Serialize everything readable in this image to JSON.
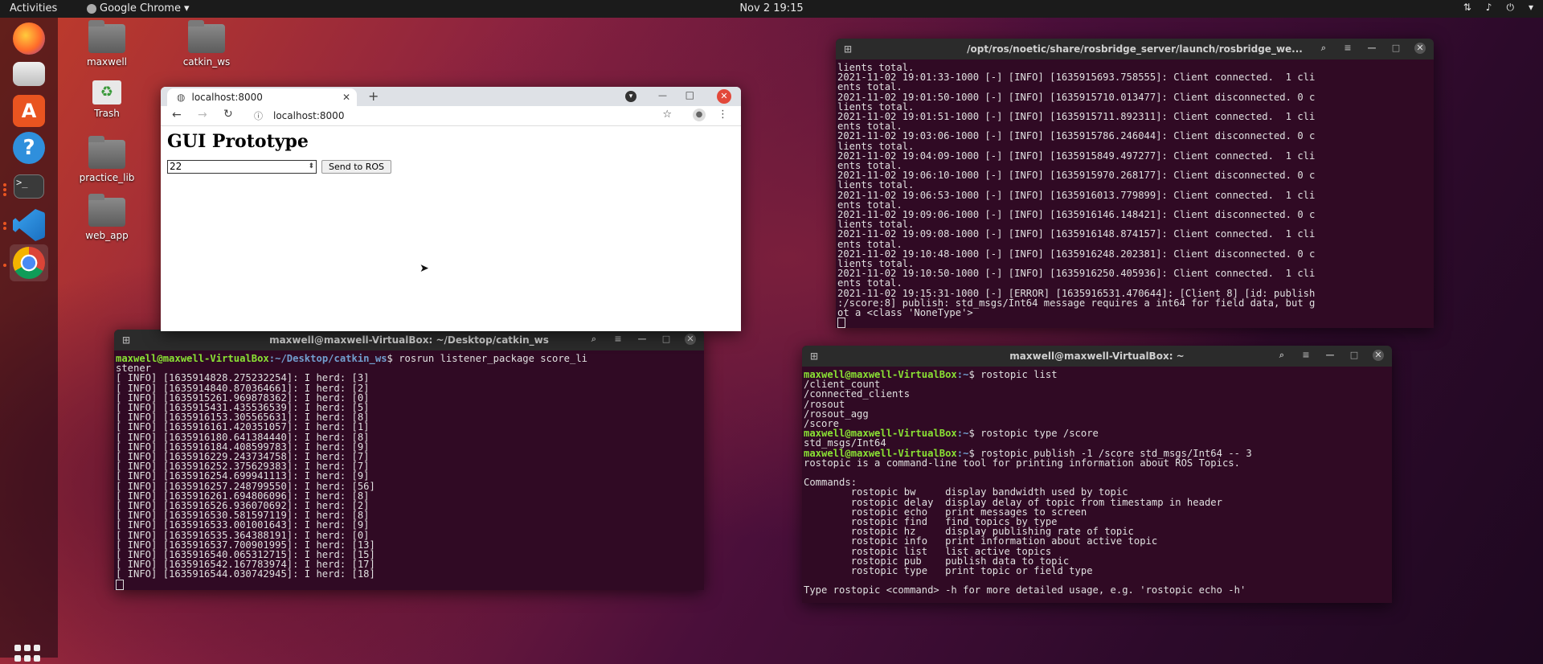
{
  "topbar": {
    "activities": "Activities",
    "app_name": "Google Chrome",
    "clock": "Nov 2  19:15"
  },
  "desktop_icons": [
    {
      "label": "maxwell"
    },
    {
      "label": "catkin_ws"
    },
    {
      "label": "Trash"
    },
    {
      "label": "practice_lib"
    },
    {
      "label": "web_app"
    }
  ],
  "browser": {
    "tab_title": "localhost:8000",
    "url": "localhost:8000",
    "heading": "GUI Prototype",
    "input_value": "22",
    "send_button": "Send to ROS"
  },
  "rosbridge_terminal": {
    "title": "/opt/ros/noetic/share/rosbridge_server/launch/rosbridge_we...",
    "lines": [
      "lients total.",
      "2021-11-02 19:01:33-1000 [-] [INFO] [1635915693.758555]: Client connected.  1 cli",
      "ents total.",
      "2021-11-02 19:01:50-1000 [-] [INFO] [1635915710.013477]: Client disconnected. 0 c",
      "lients total.",
      "2021-11-02 19:01:51-1000 [-] [INFO] [1635915711.892311]: Client connected.  1 cli",
      "ents total.",
      "2021-11-02 19:03:06-1000 [-] [INFO] [1635915786.246044]: Client disconnected. 0 c",
      "lients total.",
      "2021-11-02 19:04:09-1000 [-] [INFO] [1635915849.497277]: Client connected.  1 cli",
      "ents total.",
      "2021-11-02 19:06:10-1000 [-] [INFO] [1635915970.268177]: Client disconnected. 0 c",
      "lients total.",
      "2021-11-02 19:06:53-1000 [-] [INFO] [1635916013.779899]: Client connected.  1 cli",
      "ents total.",
      "2021-11-02 19:09:06-1000 [-] [INFO] [1635916146.148421]: Client disconnected. 0 c",
      "lients total.",
      "2021-11-02 19:09:08-1000 [-] [INFO] [1635916148.874157]: Client connected.  1 cli",
      "ents total.",
      "2021-11-02 19:10:48-1000 [-] [INFO] [1635916248.202381]: Client disconnected. 0 c",
      "lients total.",
      "2021-11-02 19:10:50-1000 [-] [INFO] [1635916250.405936]: Client connected.  1 cli",
      "ents total.",
      "2021-11-02 19:15:31-1000 [-] [ERROR] [1635916531.470644]: [Client 8] [id: publish",
      ":/score:8] publish: std_msgs/Int64 message requires a int64 for field data, but g",
      "ot a <class 'NoneType'>"
    ]
  },
  "listener_terminal": {
    "title": "maxwell@maxwell-VirtualBox: ~/Desktop/catkin_ws",
    "prompt_user": "maxwell@maxwell-VirtualBox",
    "prompt_path": ":~/Desktop/catkin_ws",
    "command": "$ rosrun listener_package score_li",
    "command_wrap": "stener",
    "lines": [
      "[ INFO] [1635914828.275232254]: I herd: [3]",
      "[ INFO] [1635914840.870364661]: I herd: [2]",
      "[ INFO] [1635915261.969878362]: I herd: [0]",
      "[ INFO] [1635915431.435536539]: I herd: [5]",
      "[ INFO] [1635916153.305565631]: I herd: [8]",
      "[ INFO] [1635916161.420351057]: I herd: [1]",
      "[ INFO] [1635916180.641384440]: I herd: [8]",
      "[ INFO] [1635916184.408599783]: I herd: [9]",
      "[ INFO] [1635916229.243734758]: I herd: [7]",
      "[ INFO] [1635916252.375629383]: I herd: [7]",
      "[ INFO] [1635916254.699941113]: I herd: [9]",
      "[ INFO] [1635916257.248799550]: I herd: [56]",
      "[ INFO] [1635916261.694806096]: I herd: [8]",
      "[ INFO] [1635916526.936070692]: I herd: [2]",
      "[ INFO] [1635916530.581597119]: I herd: [8]",
      "[ INFO] [1635916533.001001643]: I herd: [9]",
      "[ INFO] [1635916535.364388191]: I herd: [0]",
      "[ INFO] [1635916537.700901995]: I herd: [13]",
      "[ INFO] [1635916540.065312715]: I herd: [15]",
      "[ INFO] [1635916542.167783974]: I herd: [17]",
      "[ INFO] [1635916544.030742945]: I herd: [18]"
    ]
  },
  "rostopic_terminal": {
    "title": "maxwell@maxwell-VirtualBox: ~",
    "prompt_user": "maxwell@maxwell-VirtualBox",
    "prompt_path": ":~",
    "cmd1": "$ rostopic list",
    "list": [
      "/client_count",
      "/connected_clients",
      "/rosout",
      "/rosout_agg",
      "/score"
    ],
    "cmd2": "$ rostopic type /score",
    "type_out": "std_msgs/Int64",
    "cmd3": "$ rostopic publish -1 /score std_msgs/Int64 -- 3",
    "help_lines": [
      "rostopic is a command-line tool for printing information about ROS Topics.",
      "",
      "Commands:",
      "        rostopic bw     display bandwidth used by topic",
      "        rostopic delay  display delay of topic from timestamp in header",
      "        rostopic echo   print messages to screen",
      "        rostopic find   find topics by type",
      "        rostopic hz     display publishing rate of topic",
      "        rostopic info   print information about active topic",
      "        rostopic list   list active topics",
      "        rostopic pub    publish data to topic",
      "        rostopic type   print topic or field type",
      "",
      "Type rostopic <command> -h for more detailed usage, e.g. 'rostopic echo -h'"
    ]
  }
}
